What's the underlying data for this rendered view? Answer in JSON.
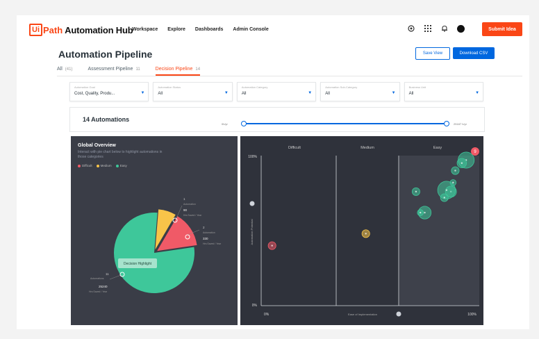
{
  "header": {
    "logo": {
      "ui": "Ui",
      "path": "Path",
      "name": "Automation Hub"
    },
    "nav": [
      "Workspace",
      "Explore",
      "Dashboards",
      "Admin Console"
    ],
    "icons": [
      "help-icon",
      "apps-grid-icon",
      "bell-icon",
      "avatar"
    ],
    "submit_label": "Submit Idea"
  },
  "page": {
    "title": "Automation Pipeline",
    "save_view_label": "Save View",
    "download_label": "Download CSV"
  },
  "tabs": [
    {
      "label": "All",
      "count": "(41)",
      "active": false
    },
    {
      "label": "Assessment Pipeline",
      "count": "11",
      "active": false
    },
    {
      "label": "Decision Pipeline",
      "count": "14",
      "active": true
    }
  ],
  "filters": [
    {
      "label": "Automation Goal",
      "value": "Cost, Quality, Produ..."
    },
    {
      "label": "Automation Status",
      "value": "All"
    },
    {
      "label": "Automation Category",
      "value": "All"
    },
    {
      "label": "Automation Sub-Category",
      "value": "All"
    },
    {
      "label": "Business Unit",
      "value": "All"
    }
  ],
  "count_bar": {
    "label": "14 Automations",
    "range_min": "0h/yr",
    "range_max": "25187 h/yr",
    "range_lower": 0.0,
    "range_upper": 1.0
  },
  "global_overview": {
    "title": "Global Overview",
    "subtitle": "Interact with pie chart below to highlight automations in those categories",
    "legend": [
      {
        "name": "Difficult",
        "color": "#f05a67"
      },
      {
        "name": "Medium",
        "color": "#f8c449"
      },
      {
        "name": "Easy",
        "color": "#3ec79a"
      }
    ],
    "tooltip": "Decision Highlight",
    "callouts": [
      {
        "count": "1",
        "count_label": "Automation",
        "hours": "90",
        "hours_label": "Hrs Saved / Year"
      },
      {
        "count": "2",
        "count_label": "Automation",
        "hours": "330",
        "hours_label": "Hrs Saved / Year"
      },
      {
        "count": "11",
        "count_label": "Automations",
        "hours": "25240",
        "hours_label": "Hrs Saved / Year"
      }
    ]
  },
  "chart_data": {
    "type": "pie",
    "slices": [
      {
        "name": "Easy",
        "automations": 11,
        "hours": 25240,
        "color": "#3ec79a"
      },
      {
        "name": "Medium",
        "automations": 1,
        "hours": 90,
        "color": "#f8c449"
      },
      {
        "name": "Difficult",
        "automations": 2,
        "hours": 330,
        "color": "#f05a67"
      }
    ]
  },
  "bubble_chart": {
    "columns": [
      "Difficult",
      "Medium",
      "Easy"
    ],
    "y_top": "100%",
    "y_bottom": "0%",
    "y_label": "Automation Potential",
    "x_left": "0%",
    "x_right": "100%",
    "x_label": "Ease of Implementation",
    "badge": "9",
    "colors": {
      "difficult": "#f05a67",
      "medium": "#f8c449",
      "easy": "#3ec79a"
    },
    "points": [
      {
        "ease": 5,
        "potential": 40,
        "size": 3,
        "group": "difficult"
      },
      {
        "ease": 48,
        "potential": 48,
        "size": 3,
        "group": "medium"
      },
      {
        "ease": 94,
        "potential": 97,
        "size": 8,
        "group": "easy"
      },
      {
        "ease": 92,
        "potential": 95,
        "size": 4,
        "group": "easy"
      },
      {
        "ease": 89,
        "potential": 90,
        "size": 3,
        "group": "easy"
      },
      {
        "ease": 88,
        "potential": 82,
        "size": 2,
        "group": "easy"
      },
      {
        "ease": 87,
        "potential": 76,
        "size": 5,
        "group": "easy"
      },
      {
        "ease": 85,
        "potential": 77,
        "size": 9,
        "group": "easy"
      },
      {
        "ease": 84,
        "potential": 72,
        "size": 3,
        "group": "easy"
      },
      {
        "ease": 71,
        "potential": 76,
        "size": 3,
        "group": "easy"
      },
      {
        "ease": 75,
        "potential": 62,
        "size": 6,
        "group": "easy"
      },
      {
        "ease": 73,
        "potential": 62,
        "size": 2,
        "group": "easy"
      }
    ]
  }
}
